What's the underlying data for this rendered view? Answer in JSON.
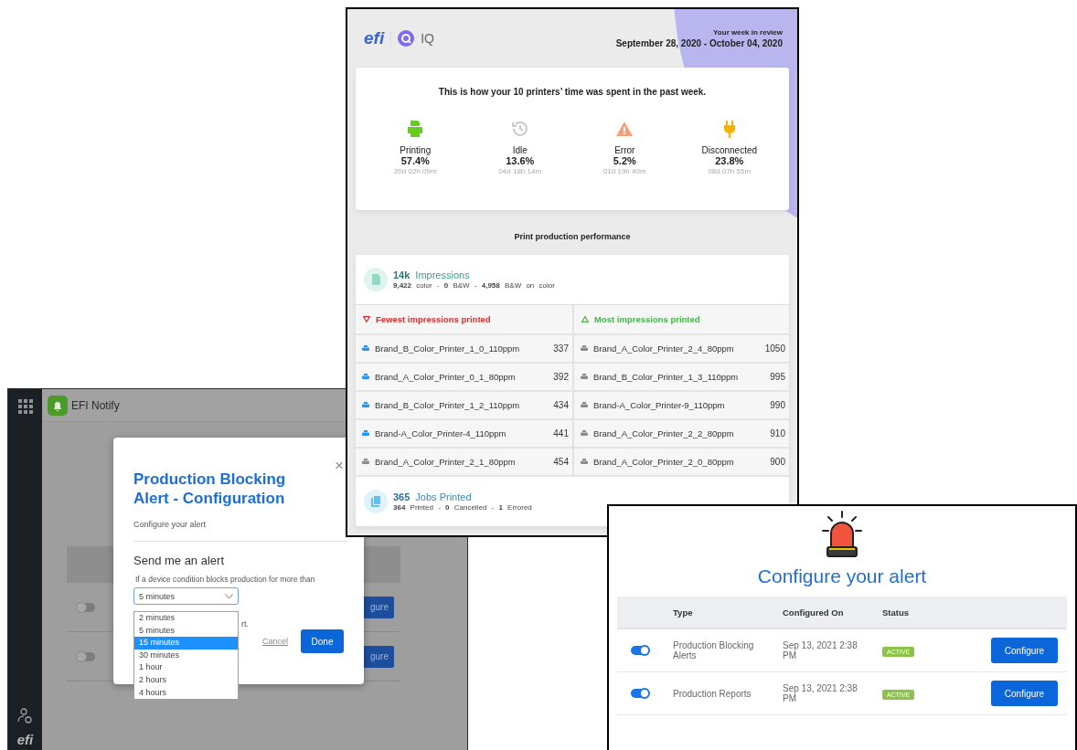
{
  "notify_app": {
    "app_name": "EFI Notify",
    "logo": "efi",
    "background_rows": [
      {
        "on": false,
        "button": "gure"
      },
      {
        "on": false,
        "button": "gure"
      }
    ],
    "dialog": {
      "close": "×",
      "title": "Production Blocking Alert - Configuration",
      "subtitle": "Configure your alert",
      "section_title": "Send me an alert",
      "prompt": "If a device condition blocks production for more than",
      "select_value": "5 minutes",
      "options": [
        {
          "label": "2 minutes",
          "selected": false
        },
        {
          "label": "5 minutes",
          "selected": false
        },
        {
          "label": "15 minutes",
          "selected": true
        },
        {
          "label": "30 minutes",
          "selected": false
        },
        {
          "label": "1 hour",
          "selected": false
        },
        {
          "label": "2 hours",
          "selected": false
        },
        {
          "label": "4 hours",
          "selected": false
        }
      ],
      "partial_text": "rt.",
      "cancel": "Cancel",
      "done": "Done"
    }
  },
  "report": {
    "logo": "efi",
    "product": "IQ",
    "period_label": "Your week in review",
    "period": "September 28, 2020 - October 04, 2020",
    "summary": {
      "heading": "This is how your 10 printers’ time was spent in the past week.",
      "stats": [
        {
          "kind": "printing",
          "color": "#66cc22",
          "label": "Printing",
          "percent": "57.4%",
          "duration": "20d 02h 09m"
        },
        {
          "kind": "idle",
          "color": "#c5c9ce",
          "label": "Idle",
          "percent": "13.6%",
          "duration": "04d 18h 14m"
        },
        {
          "kind": "error",
          "color": "#f4a07c",
          "label": "Error",
          "percent": "5.2%",
          "duration": "01d 19h 40m"
        },
        {
          "kind": "disconnected",
          "color": "#f5b400",
          "label": "Disconnected",
          "percent": "23.8%",
          "duration": "08d 07h 55m"
        }
      ]
    },
    "section_title": "Print production performance",
    "impressions": {
      "value": "14k",
      "label": "Impressions",
      "breakdown": "**9,422** color - **0** B&W - **4,958** B&W on color"
    },
    "lists": [
      {
        "kind": "fewest",
        "color": "#d32f2f",
        "title": "Fewest impressions printed",
        "rows": [
          {
            "name": "Brand_B_Color_Printer_1_0_110ppm",
            "count": "337",
            "color": "#2196f3"
          },
          {
            "name": "Brand_A_Color_Printer_0_1_80ppm",
            "count": "392",
            "color": "#2196f3"
          },
          {
            "name": "Brand_B_Color_Printer_1_2_110ppm",
            "count": "434",
            "color": "#2196f3"
          },
          {
            "name": "Brand-A_Color_Printer-4_110ppm",
            "count": "441",
            "color": "#2196f3"
          },
          {
            "name": "Brand_A_Color_Printer_2_1_80ppm",
            "count": "454",
            "color": "#8c8c8c"
          }
        ]
      },
      {
        "kind": "most",
        "color": "#4caf50",
        "title": "Most impressions printed",
        "rows": [
          {
            "name": "Brand_A_Color_Printer_2_4_80ppm",
            "count": "1050",
            "color": "#8c8c8c"
          },
          {
            "name": "Brand_B_Color_Printer_1_3_110ppm",
            "count": "995",
            "color": "#8c8c8c"
          },
          {
            "name": "Brand-A_Color_Printer-9_110ppm",
            "count": "990",
            "color": "#8c8c8c"
          },
          {
            "name": "Brand_A_Color_Printer_2_2_80ppm",
            "count": "910",
            "color": "#8c8c8c"
          },
          {
            "name": "Brand_A_Color_Printer_2_0_80ppm",
            "count": "900",
            "color": "#8c8c8c"
          }
        ]
      }
    ],
    "jobs": {
      "value": "365",
      "label": "Jobs Printed",
      "breakdown": "**364** Printed - **0** Cancelled - **1** Errored"
    }
  },
  "alerts_panel": {
    "title": "Configure your alert",
    "columns": [
      "Type",
      "Configured On",
      "Status"
    ],
    "rows": [
      {
        "on": true,
        "type": "Production Blocking Alerts",
        "configured_on": "Sep 13, 2021 2:38 PM",
        "status": "ACTIVE",
        "button": "Configure"
      },
      {
        "on": true,
        "type": "Production Reports",
        "configured_on": "Sep 13, 2021 2:38 PM",
        "status": "ACTIVE",
        "button": "Configure"
      }
    ]
  }
}
